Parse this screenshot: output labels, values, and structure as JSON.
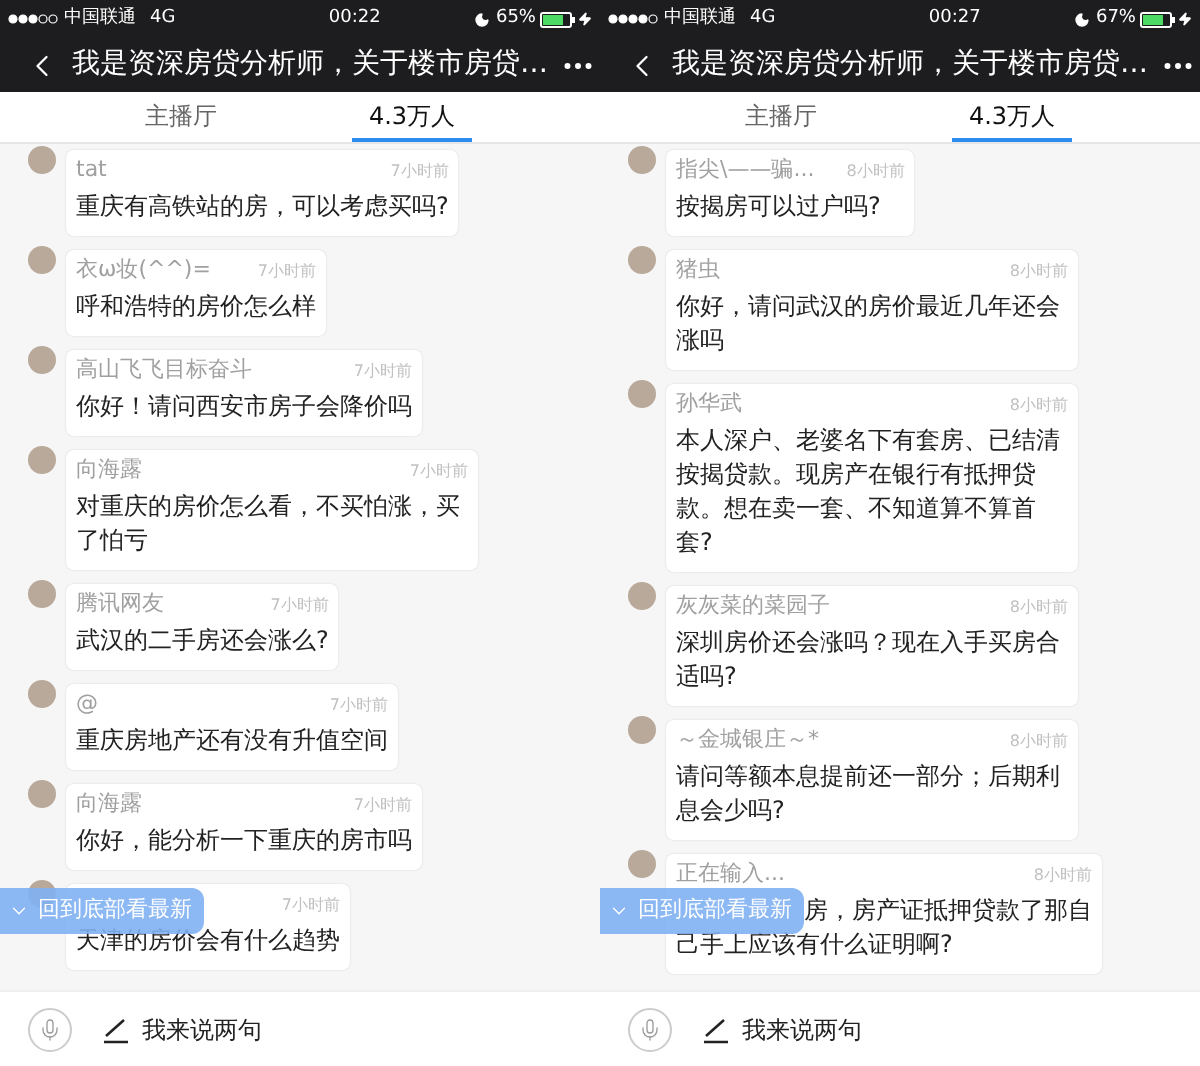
{
  "panels": [
    {
      "status_bar": {
        "carrier": "中国联通",
        "network": "4G",
        "time": "00:22",
        "battery": "65%"
      },
      "title": "我是资深房贷分析师，关于楼市房贷…",
      "tabs": [
        {
          "label": "主播厅",
          "selected": false
        },
        {
          "label": "4.3万人",
          "selected": true
        }
      ],
      "messages": [
        {
          "kind": "plain",
          "name": "tat",
          "time": "7小时前",
          "text": "重庆有高铁站的房，可以考虑买吗?"
        },
        {
          "kind": "plain",
          "name": "衣ω妆(^^)=",
          "time": "7小时前",
          "text": "呼和浩特的房价怎么样"
        },
        {
          "kind": "plain",
          "name": "高山飞飞目标奋斗",
          "time": "7小时前",
          "text": "你好！请问西安市房子会降价吗"
        },
        {
          "kind": "plain",
          "name": "向海露",
          "time": "7小时前",
          "text": "对重庆的房价怎么看，不买怕涨，买了怕亏"
        },
        {
          "kind": "plain",
          "name": "腾讯网友",
          "time": "7小时前",
          "text": "武汉的二手房还会涨么?"
        },
        {
          "kind": "plain",
          "name": "@",
          "time": "7小时前",
          "text": "重庆房地产还有没有升值空间"
        },
        {
          "kind": "plain",
          "name": "向海露",
          "time": "7小时前",
          "text": "你好，能分析一下重庆的房市吗"
        },
        {
          "kind": "name_covered",
          "time": "7小时前",
          "text": "天津的房价会有什么趋势"
        }
      ],
      "banner": "回到底部看最新",
      "input": {
        "placeholder": "我来说两句"
      }
    },
    {
      "status_bar": {
        "carrier": "中国联通",
        "network": "4G",
        "time": "00:27",
        "battery": "67%"
      },
      "title": "我是资深房贷分析师，关于楼市房贷…",
      "tabs": [
        {
          "label": "主播厅",
          "selected": false
        },
        {
          "label": "4.3万人",
          "selected": true
        }
      ],
      "messages": [
        {
          "kind": "plain",
          "name": "指尖\\——骗...",
          "time": "8小时前",
          "text": "按揭房可以过户吗?"
        },
        {
          "kind": "plain",
          "name": "猪虫",
          "time": "8小时前",
          "text": "你好，请问武汉的房价最近几年还会涨吗"
        },
        {
          "kind": "plain",
          "name": "孙华武",
          "time": "8小时前",
          "text": "本人深户、老婆名下有套房、已结清按揭贷款。现房产在银行有抵押贷款。想在卖一套、不知道算不算首套?"
        },
        {
          "kind": "plain",
          "name": "灰灰菜的菜园子",
          "time": "8小时前",
          "text": "深圳房价还会涨吗？现在入手买房合适吗?"
        },
        {
          "kind": "plain",
          "name": "～金城银庄～*",
          "time": "8小时前",
          "text": "请问等额本息提前还一部分；后期利息会少吗?"
        },
        {
          "kind": "text_covered",
          "name": "正在输入...",
          "time": "8小时前",
          "lines": [
            "房，房产证抵押贷款了那自",
            "己手上应该有什么证明啊?"
          ]
        }
      ],
      "banner": "回到底部看最新",
      "input": {
        "placeholder": "我来说两句"
      }
    }
  ]
}
